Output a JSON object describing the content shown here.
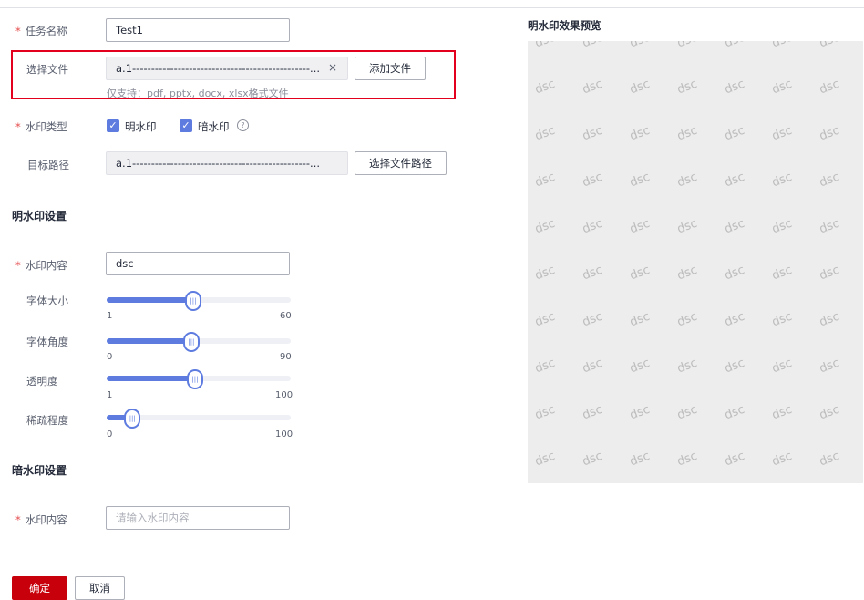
{
  "form": {
    "task_name": {
      "label": "任务名称",
      "value": "Test1"
    },
    "select_file": {
      "label": "选择文件",
      "value": "a.1-----------------------------------------------...",
      "clear_icon": "×",
      "add_button": "添加文件",
      "hint": "仅支持：pdf, pptx, docx, xlsx格式文件"
    },
    "watermark_type": {
      "label": "水印类型",
      "options": [
        {
          "label": "明水印",
          "checked": true
        },
        {
          "label": "暗水印",
          "checked": true
        }
      ],
      "help_icon": "?"
    },
    "target_path": {
      "label": "目标路径",
      "value": "a.1-----------------------------------------------...",
      "button": "选择文件路径"
    }
  },
  "visible_settings": {
    "title": "明水印设置",
    "content": {
      "label": "水印内容",
      "value": "dsc"
    },
    "sliders": [
      {
        "label": "字体大小",
        "min": "1",
        "max": "60",
        "value": 0.46
      },
      {
        "label": "字体角度",
        "min": "0",
        "max": "90",
        "value": 0.45
      },
      {
        "label": "透明度",
        "min": "1",
        "max": "100",
        "value": 0.47
      },
      {
        "label": "稀疏程度",
        "min": "0",
        "max": "100",
        "value": 0.13
      }
    ]
  },
  "hidden_settings": {
    "title": "暗水印设置",
    "content": {
      "label": "水印内容",
      "placeholder": "请输入水印内容"
    }
  },
  "footer": {
    "confirm": "确定",
    "cancel": "取消"
  },
  "preview": {
    "title": "明水印效果预览",
    "watermark_text": "dsc",
    "rows": 10,
    "cols": 7
  },
  "icons": {
    "clear": "close-icon",
    "check": "check-icon",
    "help": "help-circle-icon",
    "thumb": "slider-grip-icon"
  },
  "colors": {
    "accent": "#5e7ce0",
    "primary": "#c7000b",
    "required": "#e5494a",
    "highlight": "#e3001e",
    "preview_bg": "#ededed"
  }
}
